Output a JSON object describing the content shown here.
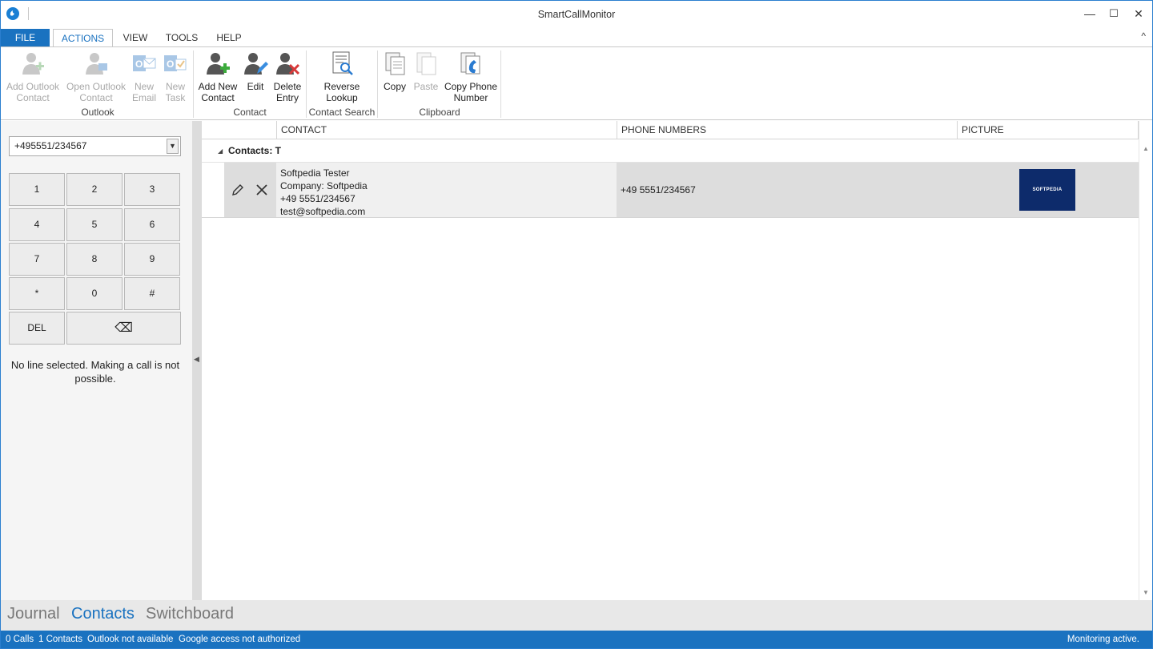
{
  "window": {
    "title": "SmartCallMonitor",
    "minimize": "—",
    "maximize": "☐",
    "close": "✕"
  },
  "ribbon_tabs": [
    "FILE",
    "ACTIONS",
    "VIEW",
    "TOOLS",
    "HELP"
  ],
  "ribbon_collapse": "^",
  "ribbon": {
    "outlook": {
      "label": "Outlook",
      "add_outlook_contact": "Add Outlook\nContact",
      "open_outlook_contact": "Open Outlook\nContact",
      "new_email": "New\nEmail",
      "new_task": "New\nTask"
    },
    "contact": {
      "label": "Contact",
      "add_new_contact": "Add New\nContact",
      "edit": "Edit",
      "delete_entry": "Delete\nEntry"
    },
    "contact_search": {
      "label": "Contact Search",
      "reverse_lookup": "Reverse\nLookup"
    },
    "clipboard": {
      "label": "Clipboard",
      "copy": "Copy",
      "paste": "Paste",
      "copy_phone_number": "Copy Phone\nNumber"
    }
  },
  "dialpad": {
    "number": "+495551/234567",
    "keys": [
      "1",
      "2",
      "3",
      "4",
      "5",
      "6",
      "7",
      "8",
      "9",
      "*",
      "0",
      "#"
    ],
    "del": "DEL",
    "backspace": "⌫",
    "message": "No line selected. Making a call is not possible."
  },
  "grid": {
    "columns": [
      "CONTACT",
      "PHONE NUMBERS",
      "PICTURE"
    ],
    "group": "Contacts: T",
    "rows": [
      {
        "contact_lines": [
          "Softpedia Tester",
          "Company: Softpedia",
          "+49 5551/234567",
          "test@softpedia.com"
        ],
        "phone": "+49 5551/234567",
        "picture_text": "SOFTPEDIA"
      }
    ]
  },
  "bottom_nav": [
    "Journal",
    "Contacts",
    "Switchboard"
  ],
  "status": {
    "calls": "0 Calls",
    "contacts": "1 Contacts",
    "outlook": "Outlook not available",
    "google": "Google access not authorized",
    "monitoring": "Monitoring active."
  },
  "colors": {
    "accent": "#1a72c0",
    "status_bar": "#1a72c0",
    "row_highlight": "#dddddd"
  }
}
